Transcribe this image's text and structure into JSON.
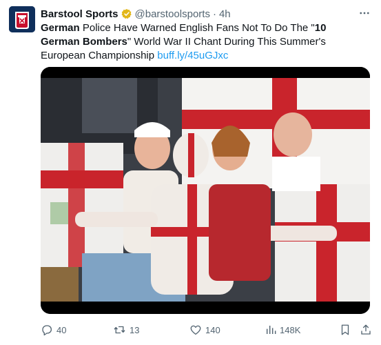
{
  "author": {
    "name": "Barstool Sports",
    "handle": "@barstoolsports",
    "separator": "·",
    "time": "4h",
    "verified_color": "#e2b719"
  },
  "tweet": {
    "text_bold_1": "German",
    "text_1": " Police Have Warned English Fans Not To Do The \"",
    "text_bold_2": "10 German Bombers",
    "text_2": "\" World War II Chant During This Summer's European Championship ",
    "link": "buff.ly/45uGJxc",
    "link_color": "#1d9bf0"
  },
  "media": {
    "alt_subject": "England fans with St George's cross flags and face paint"
  },
  "actions": {
    "replies": "40",
    "reposts": "13",
    "likes": "140",
    "views": "148K"
  },
  "icons": {
    "avatar": "barstool-logo-icon",
    "verified": "verified-badge-icon",
    "more": "more-dots-icon",
    "reply": "reply-icon",
    "repost": "repost-icon",
    "like": "heart-icon",
    "views": "analytics-icon",
    "bookmark": "bookmark-icon",
    "share": "share-icon"
  }
}
